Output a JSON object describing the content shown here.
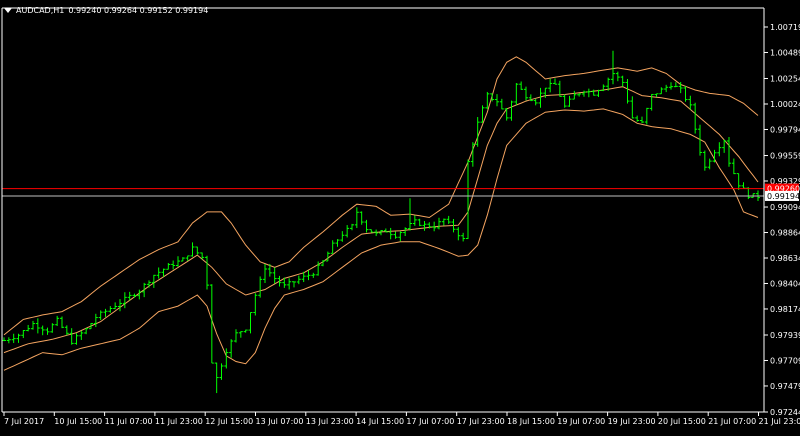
{
  "header": {
    "symbol": "AUDCAD,H1",
    "ohlc": "0.99240 0.99264 0.99152 0.99194"
  },
  "chart_data": {
    "type": "candlestick",
    "ylim": [
      0.97244,
      1.00719
    ],
    "y_ticks": [
      "1.00719",
      "1.00489",
      "1.00254",
      "1.00024",
      "0.99794",
      "0.99559",
      "0.99329",
      "0.99094",
      "0.98864",
      "0.98634",
      "0.98404",
      "0.98174",
      "0.97939",
      "0.97709",
      "0.97479",
      "0.97244"
    ],
    "x_ticks": [
      "7 Jul 2017",
      "10 Jul 15:00",
      "11 Jul 07:00",
      "11 Jul 23:00",
      "12 Jul 15:00",
      "13 Jul 07:00",
      "13 Jul 23:00",
      "14 Jul 15:00",
      "17 Jul 07:00",
      "17 Jul 23:00",
      "18 Jul 15:00",
      "19 Jul 07:00",
      "19 Jul 23:00",
      "20 Jul 15:00",
      "21 Jul 07:00",
      "21 Jul 23:00"
    ],
    "bid_price": "0.99194",
    "ask_price": "0.99260",
    "bid_value": 0.99194,
    "ask_value": 0.9926,
    "close_path": [
      [
        0,
        0.9789
      ],
      [
        3,
        0.9794
      ],
      [
        6,
        0.9804
      ],
      [
        9,
        0.9798
      ],
      [
        11,
        0.9807
      ],
      [
        14,
        0.9788
      ],
      [
        17,
        0.9799
      ],
      [
        19,
        0.981
      ],
      [
        22,
        0.9818
      ],
      [
        25,
        0.9826
      ],
      [
        28,
        0.9834
      ],
      [
        31,
        0.9848
      ],
      [
        34,
        0.9856
      ],
      [
        37,
        0.9862
      ],
      [
        39,
        0.9872
      ],
      [
        41,
        0.9864
      ],
      [
        42,
        0.984
      ],
      [
        43,
        0.977
      ],
      [
        44,
        0.9755
      ],
      [
        46,
        0.978
      ],
      [
        48,
        0.9795
      ],
      [
        50,
        0.98
      ],
      [
        52,
        0.983
      ],
      [
        54,
        0.9855
      ],
      [
        56,
        0.9845
      ],
      [
        58,
        0.9838
      ],
      [
        60,
        0.9842
      ],
      [
        62,
        0.9846
      ],
      [
        64,
        0.985
      ],
      [
        66,
        0.986
      ],
      [
        68,
        0.9875
      ],
      [
        70,
        0.9885
      ],
      [
        72,
        0.9892
      ],
      [
        73,
        0.9905
      ],
      [
        75,
        0.989
      ],
      [
        77,
        0.9885
      ],
      [
        79,
        0.9888
      ],
      [
        81,
        0.9884
      ],
      [
        83,
        0.989
      ],
      [
        85,
        0.9896
      ],
      [
        87,
        0.9893
      ],
      [
        89,
        0.9892
      ],
      [
        91,
        0.9898
      ],
      [
        93,
        0.989
      ],
      [
        95,
        0.988
      ],
      [
        96,
        0.995
      ],
      [
        98,
        0.9985
      ],
      [
        100,
        1.001
      ],
      [
        102,
        1.0005
      ],
      [
        104,
        0.999
      ],
      [
        106,
        1.002
      ],
      [
        108,
        1.001
      ],
      [
        110,
        1.0005
      ],
      [
        112,
        1.0018
      ],
      [
        114,
        1.002
      ],
      [
        116,
        1.0
      ],
      [
        118,
        1.001
      ],
      [
        120,
        1.0015
      ],
      [
        122,
        1.0012
      ],
      [
        124,
        1.002
      ],
      [
        126,
        1.003
      ],
      [
        128,
        1.0022
      ],
      [
        130,
        0.999
      ],
      [
        132,
        0.9985
      ],
      [
        134,
        1.001
      ],
      [
        136,
        1.0015
      ],
      [
        138,
        1.002
      ],
      [
        140,
        1.0015
      ],
      [
        142,
        1.0
      ],
      [
        144,
        0.996
      ],
      [
        145,
        0.9945
      ],
      [
        147,
        0.996
      ],
      [
        149,
        0.997
      ],
      [
        150,
        0.995
      ],
      [
        152,
        0.993
      ],
      [
        154,
        0.992
      ],
      [
        156,
        0.9919
      ]
    ],
    "band_upper": [
      [
        0,
        0.9794
      ],
      [
        4,
        0.9808
      ],
      [
        8,
        0.9812
      ],
      [
        12,
        0.9815
      ],
      [
        16,
        0.9824
      ],
      [
        20,
        0.9838
      ],
      [
        24,
        0.985
      ],
      [
        28,
        0.9862
      ],
      [
        32,
        0.9871
      ],
      [
        36,
        0.9878
      ],
      [
        39,
        0.9895
      ],
      [
        42,
        0.9905
      ],
      [
        45,
        0.9905
      ],
      [
        47,
        0.9895
      ],
      [
        50,
        0.9875
      ],
      [
        53,
        0.986
      ],
      [
        56,
        0.9855
      ],
      [
        59,
        0.986
      ],
      [
        62,
        0.9873
      ],
      [
        66,
        0.9887
      ],
      [
        70,
        0.9902
      ],
      [
        73,
        0.9912
      ],
      [
        77,
        0.991
      ],
      [
        80,
        0.9902
      ],
      [
        84,
        0.9903
      ],
      [
        88,
        0.99
      ],
      [
        92,
        0.9912
      ],
      [
        96,
        0.995
      ],
      [
        100,
        0.9995
      ],
      [
        102,
        1.0025
      ],
      [
        104,
        1.004
      ],
      [
        106,
        1.0045
      ],
      [
        108,
        1.004
      ],
      [
        112,
        1.0025
      ],
      [
        116,
        1.0028
      ],
      [
        120,
        1.003
      ],
      [
        124,
        1.0033
      ],
      [
        127,
        1.0035
      ],
      [
        131,
        1.0032
      ],
      [
        134,
        1.0035
      ],
      [
        137,
        1.003
      ],
      [
        140,
        1.002
      ],
      [
        143,
        1.0015
      ],
      [
        146,
        1.0012
      ],
      [
        150,
        1.001
      ],
      [
        153,
        1.0003
      ],
      [
        156,
        0.9992
      ]
    ],
    "band_mid": [
      [
        0,
        0.9778
      ],
      [
        5,
        0.9786
      ],
      [
        10,
        0.979
      ],
      [
        15,
        0.9796
      ],
      [
        20,
        0.9806
      ],
      [
        25,
        0.9822
      ],
      [
        30,
        0.9838
      ],
      [
        35,
        0.9852
      ],
      [
        40,
        0.9866
      ],
      [
        43,
        0.9855
      ],
      [
        46,
        0.984
      ],
      [
        50,
        0.983
      ],
      [
        54,
        0.9835
      ],
      [
        58,
        0.9845
      ],
      [
        62,
        0.985
      ],
      [
        66,
        0.986
      ],
      [
        70,
        0.9873
      ],
      [
        74,
        0.9885
      ],
      [
        78,
        0.9887
      ],
      [
        82,
        0.9888
      ],
      [
        86,
        0.989
      ],
      [
        90,
        0.9892
      ],
      [
        94,
        0.9893
      ],
      [
        96,
        0.9905
      ],
      [
        98,
        0.9935
      ],
      [
        100,
        0.9965
      ],
      [
        102,
        0.9985
      ],
      [
        104,
        0.9998
      ],
      [
        108,
        1.0005
      ],
      [
        112,
        1.001
      ],
      [
        116,
        1.0011
      ],
      [
        120,
        1.0013
      ],
      [
        124,
        1.0015
      ],
      [
        128,
        1.0018
      ],
      [
        132,
        1.001
      ],
      [
        136,
        1.0008
      ],
      [
        140,
        1.0005
      ],
      [
        144,
        0.999
      ],
      [
        148,
        0.9975
      ],
      [
        152,
        0.9955
      ],
      [
        156,
        0.9932
      ]
    ],
    "band_lower": [
      [
        0,
        0.9762
      ],
      [
        4,
        0.977
      ],
      [
        8,
        0.9778
      ],
      [
        12,
        0.9776
      ],
      [
        16,
        0.9782
      ],
      [
        20,
        0.9786
      ],
      [
        24,
        0.979
      ],
      [
        28,
        0.98
      ],
      [
        32,
        0.9815
      ],
      [
        36,
        0.982
      ],
      [
        40,
        0.983
      ],
      [
        42,
        0.982
      ],
      [
        44,
        0.9795
      ],
      [
        46,
        0.9775
      ],
      [
        48,
        0.977
      ],
      [
        50,
        0.9768
      ],
      [
        52,
        0.9778
      ],
      [
        54,
        0.98
      ],
      [
        56,
        0.9818
      ],
      [
        58,
        0.983
      ],
      [
        62,
        0.9835
      ],
      [
        66,
        0.9842
      ],
      [
        70,
        0.9855
      ],
      [
        74,
        0.9868
      ],
      [
        78,
        0.9875
      ],
      [
        82,
        0.9878
      ],
      [
        86,
        0.9878
      ],
      [
        90,
        0.9872
      ],
      [
        94,
        0.9865
      ],
      [
        96,
        0.9866
      ],
      [
        98,
        0.9875
      ],
      [
        100,
        0.9902
      ],
      [
        102,
        0.9935
      ],
      [
        104,
        0.9965
      ],
      [
        106,
        0.9975
      ],
      [
        108,
        0.9985
      ],
      [
        112,
        0.9995
      ],
      [
        116,
        0.9997
      ],
      [
        120,
        0.9996
      ],
      [
        124,
        0.9998
      ],
      [
        128,
        0.9993
      ],
      [
        131,
        0.9985
      ],
      [
        134,
        0.9982
      ],
      [
        138,
        0.998
      ],
      [
        142,
        0.9975
      ],
      [
        145,
        0.9968
      ],
      [
        148,
        0.9945
      ],
      [
        151,
        0.9925
      ],
      [
        153,
        0.9905
      ],
      [
        156,
        0.99
      ]
    ],
    "colors": {
      "candle": "#00ff00",
      "band": "#f4a460",
      "ask_line": "#ff0000",
      "bid_line": "#c0c0c0",
      "axis": "#ffffff",
      "background": "#000000"
    }
  }
}
